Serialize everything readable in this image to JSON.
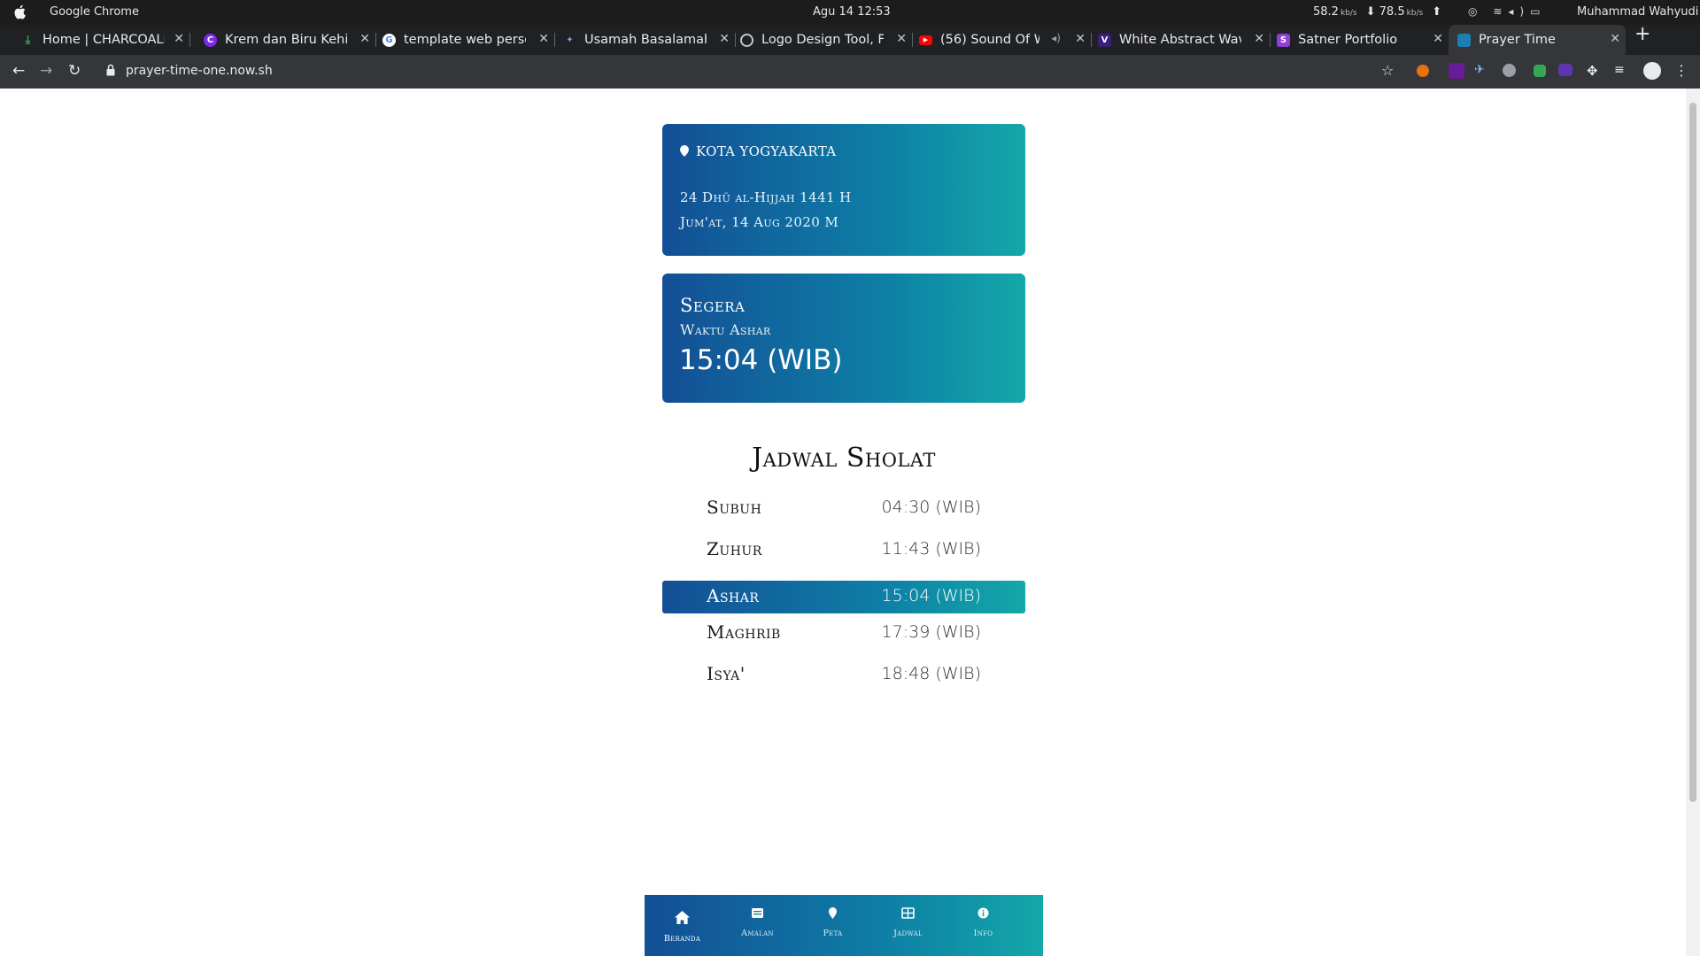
{
  "os": {
    "app_name": "Google Chrome",
    "clock": "Agu 14  12:53",
    "net_down": "58.2",
    "net_up": "78.5",
    "net_unit": "kb/s",
    "user": "Muhammad Wahyudi"
  },
  "browser": {
    "tabs": [
      {
        "title": "Home | CHARCOALM",
        "favicon": "download-green-icon",
        "color": "#34a853"
      },
      {
        "title": "Krem dan Biru Kehij",
        "favicon": "canva-icon",
        "color": "#7d2ae8"
      },
      {
        "title": "template web perso",
        "favicon": "google-icon",
        "color": "#4285f4"
      },
      {
        "title": "Usamah Basalamah",
        "favicon": "site-icon",
        "color": "#5f6ad6"
      },
      {
        "title": "Logo Design Tool, F",
        "favicon": "globe-icon",
        "color": "#9aa0a6"
      },
      {
        "title": "(56) Sound Of W",
        "favicon": "youtube-icon",
        "color": "#ff0000"
      },
      {
        "title": "White Abstract Wav",
        "favicon": "vectorstock-icon",
        "color": "#3b1f7a"
      },
      {
        "title": "Satner Portfolio",
        "favicon": "satner-icon",
        "color": "#8e3fd6"
      },
      {
        "title": "Prayer Time",
        "favicon": "prayer-icon",
        "color": "#1c7fb0"
      }
    ],
    "url": "prayer-time-one.now.sh"
  },
  "location": {
    "city": "KOTA YOGYAKARTA",
    "hijri_date": "24 Dhū al-Hijjah 1441 H",
    "gregorian_date": "Jum'at, 14 Aug 2020 M"
  },
  "next_prayer": {
    "label": "Segera",
    "name": "Waktu Ashar",
    "time": "15:04 (WIB)"
  },
  "schedule": {
    "title": "Jadwal Sholat",
    "rows": [
      {
        "name": "Subuh",
        "time": "04:30 (WIB)"
      },
      {
        "name": "Zuhur",
        "time": "11:43 (WIB)"
      },
      {
        "name": "Ashar",
        "time": "15:04 (WIB)"
      },
      {
        "name": "Maghrib",
        "time": "17:39 (WIB)"
      },
      {
        "name": "Isya'",
        "time": "18:48 (WIB)"
      }
    ]
  },
  "bottom_nav": [
    {
      "label": "Beranda",
      "icon": "home-icon"
    },
    {
      "label": "Amalan",
      "icon": "book-icon"
    },
    {
      "label": "Peta",
      "icon": "map-pin-icon"
    },
    {
      "label": "Jadwal",
      "icon": "table-icon"
    },
    {
      "label": "Info",
      "icon": "info-icon"
    }
  ]
}
